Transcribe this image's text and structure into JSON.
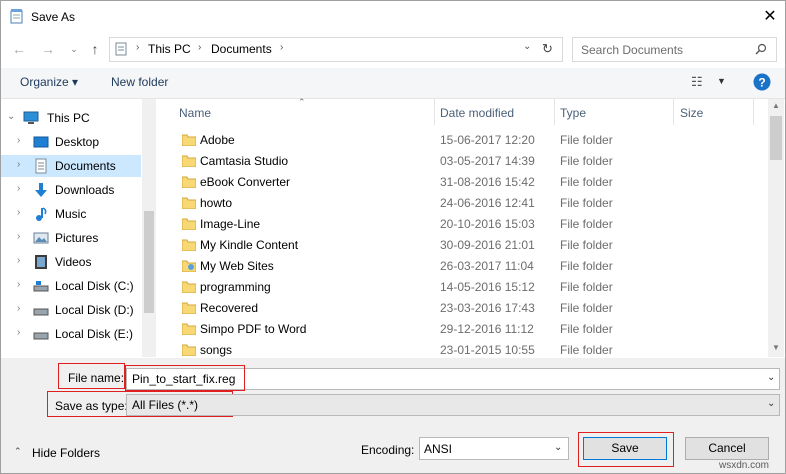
{
  "window": {
    "title": "Save As"
  },
  "address": {
    "crumbs": [
      "This PC",
      "Documents"
    ]
  },
  "search": {
    "placeholder": "Search Documents"
  },
  "toolbar": {
    "organize": "Organize ▾",
    "new_folder": "New folder"
  },
  "tree": {
    "items": [
      {
        "label": "This PC",
        "icon": "pc-icon"
      },
      {
        "label": "Desktop",
        "icon": "desktop-icon"
      },
      {
        "label": "Documents",
        "icon": "documents-icon",
        "selected": true
      },
      {
        "label": "Downloads",
        "icon": "downloads-icon"
      },
      {
        "label": "Music",
        "icon": "music-icon"
      },
      {
        "label": "Pictures",
        "icon": "pictures-icon"
      },
      {
        "label": "Videos",
        "icon": "videos-icon"
      },
      {
        "label": "Local Disk (C:)",
        "icon": "drive-icon"
      },
      {
        "label": "Local Disk (D:)",
        "icon": "drive-icon"
      },
      {
        "label": "Local Disk (E:)",
        "icon": "drive-icon"
      }
    ]
  },
  "columns": {
    "name": "Name",
    "date": "Date modified",
    "type": "Type",
    "size": "Size"
  },
  "files": [
    {
      "name": "Adobe",
      "date": "15-06-2017 12:20",
      "type": "File folder"
    },
    {
      "name": "Camtasia Studio",
      "date": "03-05-2017 14:39",
      "type": "File folder"
    },
    {
      "name": "eBook Converter",
      "date": "31-08-2016 15:42",
      "type": "File folder"
    },
    {
      "name": "howto",
      "date": "24-06-2016 12:41",
      "type": "File folder"
    },
    {
      "name": "Image-Line",
      "date": "20-10-2016 15:03",
      "type": "File folder"
    },
    {
      "name": "My Kindle Content",
      "date": "30-09-2016 21:01",
      "type": "File folder"
    },
    {
      "name": "My Web Sites",
      "date": "26-03-2017 11:04",
      "type": "File folder"
    },
    {
      "name": "programming",
      "date": "14-05-2016 15:12",
      "type": "File folder"
    },
    {
      "name": "Recovered",
      "date": "23-03-2016 17:43",
      "type": "File folder"
    },
    {
      "name": "Simpo PDF to Word",
      "date": "29-12-2016 11:12",
      "type": "File folder"
    },
    {
      "name": "songs",
      "date": "23-01-2015 10:55",
      "type": "File folder"
    }
  ],
  "form": {
    "file_name_label": "File name:",
    "file_name_value": "Pin_to_start_fix.reg",
    "save_type_label": "Save as type:",
    "save_type_value": "All Files  (*.*)",
    "encoding_label": "Encoding:",
    "encoding_value": "ANSI"
  },
  "footer": {
    "hide_folders": "Hide Folders",
    "save": "Save",
    "cancel": "Cancel"
  },
  "watermark": "wsxdn.com",
  "colors": {
    "selection": "#cce8ff",
    "highlight_box": "#e02020",
    "folder": "#f8d775",
    "help": "#1a73c8"
  }
}
